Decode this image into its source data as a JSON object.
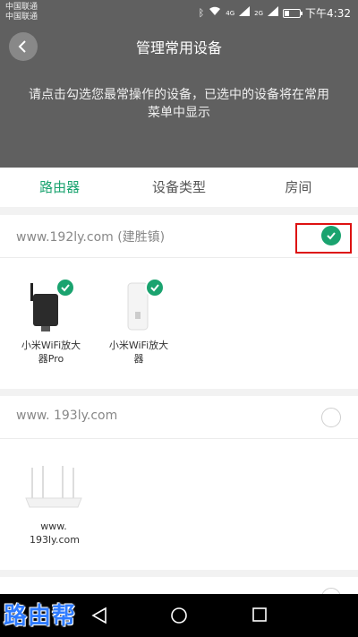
{
  "status_bar": {
    "carrier1": "中国联通",
    "carrier2": "中国联通",
    "network1": "4G",
    "network2": "2G",
    "time": "下午4:32"
  },
  "header": {
    "title": "管理常用设备",
    "subtitle": "请点击勾选您最常操作的设备，已选中的设备将在常用菜单中显示"
  },
  "tabs": [
    {
      "label": "路由器",
      "active": true
    },
    {
      "label": "设备类型",
      "active": false
    },
    {
      "label": "房间",
      "active": false
    }
  ],
  "groups": [
    {
      "title": "www.192ly.com (建胜镇)",
      "checked": true,
      "devices": [
        {
          "label": "小米WiFi放大器Pro",
          "checked": true
        },
        {
          "label": "小米WiFi放大器",
          "checked": true
        }
      ]
    },
    {
      "title": "www. 193ly.com",
      "checked": false,
      "devices": [
        {
          "label": "www. 193ly.com",
          "checked": false
        }
      ]
    }
  ],
  "watermark": "路由帮",
  "colors": {
    "accent": "#1aa36f",
    "header": "#606060",
    "highlight": "#d11111"
  },
  "icons": [
    "back-arrow-icon",
    "check-icon",
    "nav-back-icon",
    "nav-home-icon",
    "nav-recent-icon"
  ]
}
